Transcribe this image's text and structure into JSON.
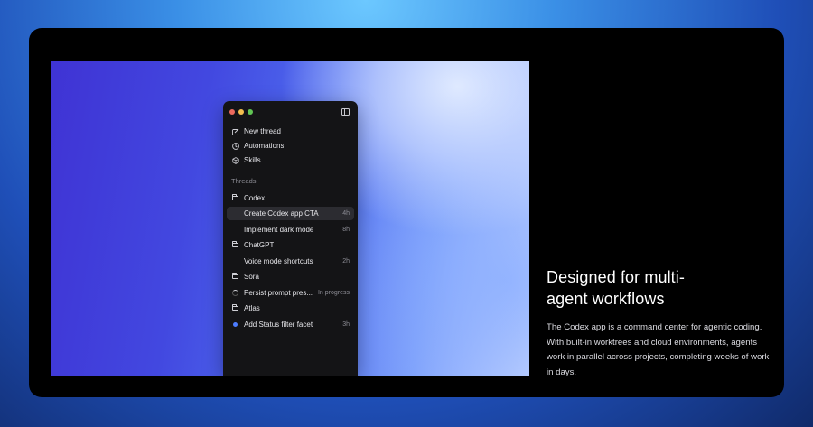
{
  "app": {
    "nav": [
      {
        "label": "New thread",
        "icon": "edit-icon"
      },
      {
        "label": "Automations",
        "icon": "clock-icon"
      },
      {
        "label": "Skills",
        "icon": "cube-icon"
      }
    ],
    "threads_heading": "Threads",
    "threads": [
      {
        "kind": "folder",
        "label": "Codex"
      },
      {
        "kind": "thread",
        "label": "Create Codex app CTA",
        "meta": "4h",
        "active": true
      },
      {
        "kind": "thread",
        "label": "Implement dark mode",
        "meta": "8h"
      },
      {
        "kind": "folder",
        "label": "ChatGPT"
      },
      {
        "kind": "thread",
        "label": "Voice mode shortcuts",
        "meta": "2h"
      },
      {
        "kind": "folder",
        "label": "Sora"
      },
      {
        "kind": "thread",
        "label": "Persist prompt pres...",
        "meta": "In progress",
        "status_icon": "spinner-icon"
      },
      {
        "kind": "folder",
        "label": "Atlas"
      },
      {
        "kind": "thread",
        "label": "Add Status filter facet",
        "meta": "3h",
        "status_icon": "blue-dot-icon"
      }
    ]
  },
  "copy": {
    "headline_line1": "Designed for multi-",
    "headline_line2": "agent workflows",
    "body": "The Codex app is a command center for agentic coding. With built-in worktrees and cloud environments, agents work in parallel across projects, completing weeks of work in days."
  },
  "colors": {
    "accent_dot": "#4d7dff",
    "traffic_red": "#ec6a5e",
    "traffic_yellow": "#f4bf4f",
    "traffic_green": "#61c554"
  }
}
